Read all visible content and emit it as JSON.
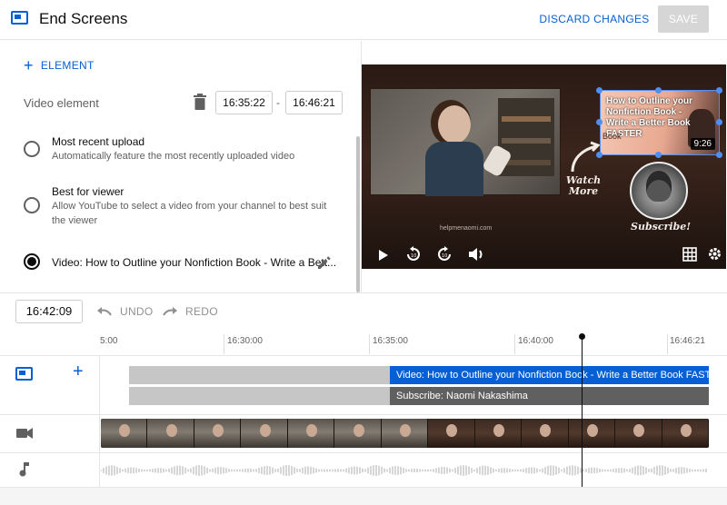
{
  "header": {
    "title": "End Screens",
    "discard_label": "DISCARD CHANGES",
    "save_label": "SAVE",
    "icon": "end-screen-icon"
  },
  "panel": {
    "add_element_label": "ELEMENT",
    "video_element_label": "Video element",
    "start_time": "16:35:22",
    "end_time": "16:46:21",
    "options": [
      {
        "title": "Most recent upload",
        "description": "Automatically feature the most recently uploaded video",
        "selected": false
      },
      {
        "title": "Best for viewer",
        "description": "Allow YouTube to select a video from your channel to best suit the viewer",
        "selected": false
      },
      {
        "title": "Video: How to Outline your Nonfiction Book - Write a Bett...",
        "description": "",
        "selected": true
      }
    ]
  },
  "preview": {
    "card_title": "How to Outline your Nonfiction Book - Write a Better Book FASTER",
    "card_word": "Book",
    "card_duration": "9:26",
    "watch_more": "Watch More",
    "subscribe_text": "Subscribe!",
    "watermark": "helpmenaomi.com"
  },
  "toolbar": {
    "current_time": "16:42:09",
    "undo_label": "UNDO",
    "redo_label": "REDO"
  },
  "timeline": {
    "ticks": [
      "5:00",
      "16:30:00",
      "16:35:00",
      "16:40:00",
      "16:46:21"
    ],
    "video_bar_label": "Video: How to Outline your Nonfiction Book - Write a Better Book FASTER",
    "subscribe_bar_label": "Subscribe: Naomi Nakashima"
  },
  "colors": {
    "accent": "#065fd4",
    "element_bar": "#065fd4",
    "subscribe_bar": "#606060"
  }
}
